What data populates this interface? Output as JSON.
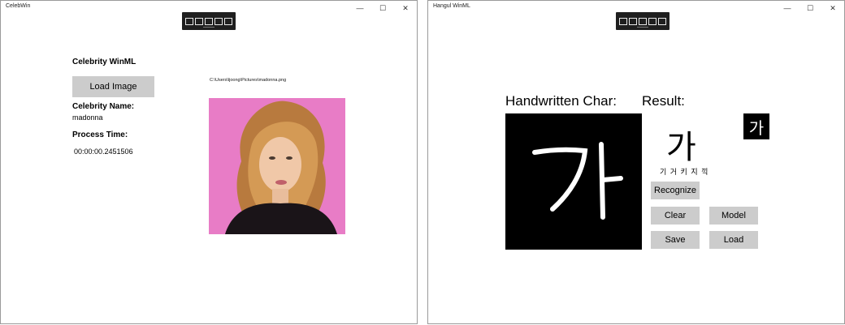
{
  "left": {
    "title": "CelebWin",
    "heading": "Celebrity WinML",
    "load_button": "Load Image",
    "file_path": "C:\\Users\\ljoong\\Pictures\\madonna.png",
    "name_label": "Celebrity Name:",
    "name_value": "madonna",
    "time_label": "Process Time:",
    "time_value": "00:00:00.2451506",
    "photo_bg": "#e879c4"
  },
  "right": {
    "title": "Hangul WinML",
    "handwritten_label": "Handwritten Char:",
    "result_label": "Result:",
    "drawn_char": "가",
    "result_char": "가",
    "candidates": "기 거 키 지 끽",
    "box_char": "가",
    "buttons": {
      "recognize": "Recognize",
      "clear": "Clear",
      "model": "Model",
      "save": "Save",
      "load": "Load"
    }
  },
  "window_controls": {
    "minimize": "—",
    "maximize": "☐",
    "close": "✕"
  }
}
